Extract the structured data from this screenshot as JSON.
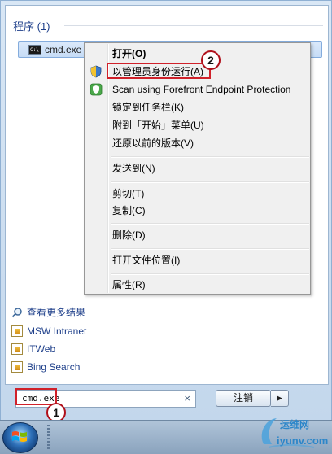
{
  "programs_section": {
    "title": "程序 (1)",
    "item_label": "cmd.exe",
    "item_icon": "command-prompt-icon"
  },
  "context_menu": {
    "items": [
      {
        "label": "打开(O)",
        "bold": true
      },
      {
        "label": "以管理员身份运行(A)",
        "icon": "uac-shield-icon"
      },
      {
        "label": "Scan using Forefront Endpoint Protection",
        "icon": "forefront-shield-icon"
      },
      {
        "label": "锁定到任务栏(K)"
      },
      {
        "label": "附到「开始」菜单(U)"
      },
      {
        "label": "还原以前的版本(V)"
      },
      {
        "label": "发送到(N)"
      },
      {
        "label": "剪切(T)"
      },
      {
        "label": "复制(C)"
      },
      {
        "label": "删除(D)"
      },
      {
        "label": "打开文件位置(I)"
      },
      {
        "label": "属性(R)"
      }
    ]
  },
  "annotations": {
    "step1": "1",
    "step2": "2",
    "highlight_color": "#d0212a"
  },
  "links": [
    {
      "label": "查看更多结果",
      "icon": "search-icon"
    },
    {
      "label": "MSW Intranet",
      "icon": "document-icon"
    },
    {
      "label": "ITWeb",
      "icon": "document-icon"
    },
    {
      "label": "Bing Search",
      "icon": "document-icon"
    }
  ],
  "search": {
    "value": "cmd.exe",
    "clear_icon": "×"
  },
  "logoff": {
    "label": "注销",
    "arrow": "▶"
  },
  "watermark": {
    "top": "运维网",
    "bottom": "iyunv.com"
  }
}
